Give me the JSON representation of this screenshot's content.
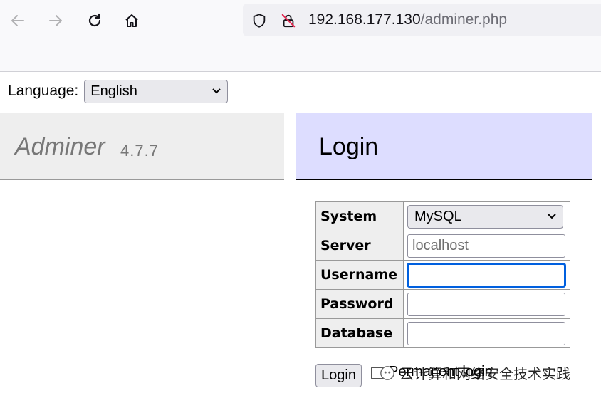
{
  "browser": {
    "url_host": "192.168.177.130",
    "url_path": "/adminer.php",
    "icons": [
      "back-arrow-icon",
      "forward-arrow-icon",
      "reload-icon",
      "home-icon",
      "shield-icon",
      "insecure-lock-icon"
    ]
  },
  "language": {
    "label": "Language:",
    "selected": "English"
  },
  "brand": {
    "name": "Adminer",
    "version": "4.7.7"
  },
  "login": {
    "title": "Login",
    "fields": {
      "system_label": "System",
      "system_value": "MySQL",
      "server_label": "Server",
      "server_placeholder": "localhost",
      "username_label": "Username",
      "username_value": "",
      "password_label": "Password",
      "password_value": "",
      "database_label": "Database",
      "database_value": ""
    },
    "submit_label": "Login",
    "permanent_label": "Permanent login"
  },
  "watermark": {
    "text": "云计算和网络安全技术实践"
  },
  "colors": {
    "brand_bg": "#eeeeee",
    "login_head_bg": "#ddddff",
    "focus": "#0060df"
  }
}
